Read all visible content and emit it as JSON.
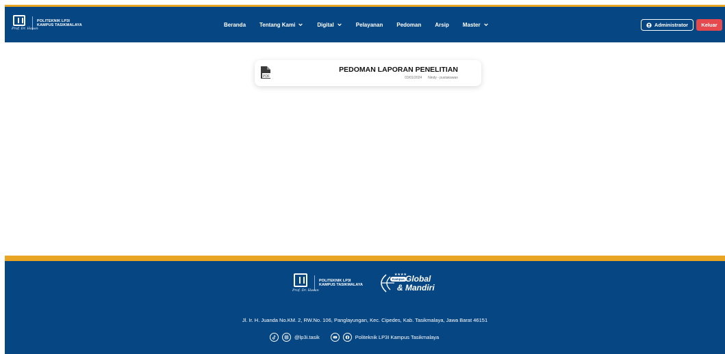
{
  "brand": {
    "line1": "POLITEKNIK LP3I",
    "line2": "KAMPUS TASIKMALAYA",
    "signature": "Prof. Dr. Hasan"
  },
  "nav": {
    "items": [
      {
        "label": "Beranda",
        "dropdown": false
      },
      {
        "label": "Tentang Kami",
        "dropdown": true
      },
      {
        "label": "Digital",
        "dropdown": true
      },
      {
        "label": "Pelayanan",
        "dropdown": false
      },
      {
        "label": "Pedoman",
        "dropdown": false
      },
      {
        "label": "Arsip",
        "dropdown": false
      },
      {
        "label": "Master",
        "dropdown": true
      }
    ]
  },
  "user": {
    "admin_label": "Administrator",
    "logout_label": "Keluar"
  },
  "document": {
    "icon_label": "PDF",
    "title": "PEDOMAN LAPORAN PENELITIAN",
    "date": "03/01/2024",
    "author": "Nindy - pustakawan"
  },
  "footer": {
    "brand_line1": "POLITEKNIK LP3I",
    "brand_line2": "KAMPUS TASIKMALAYA",
    "campaign_badge": "Kampus",
    "campaign_global": "Global",
    "campaign_mandiri": "& Mandiri",
    "address": "Jl. Ir. H. Juanda No.KM. 2, RW.No. 106, Panglayungan, Kec. Cipedes, Kab. Tasikmalaya, Jawa Barat 46151",
    "instagram_handle": "@lp3i.tasik",
    "facebook_name": "Politeknik LP3I Kampus Tasikmalaya"
  },
  "colors": {
    "primary": "#064683",
    "accent": "#e8a524",
    "danger": "#e5484d"
  }
}
